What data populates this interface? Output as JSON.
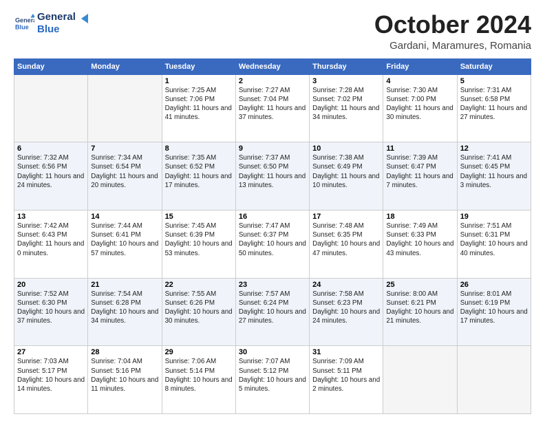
{
  "header": {
    "logo_line1": "General",
    "logo_line2": "Blue",
    "month": "October 2024",
    "location": "Gardani, Maramures, Romania"
  },
  "weekdays": [
    "Sunday",
    "Monday",
    "Tuesday",
    "Wednesday",
    "Thursday",
    "Friday",
    "Saturday"
  ],
  "weeks": [
    [
      {
        "day": "",
        "info": ""
      },
      {
        "day": "",
        "info": ""
      },
      {
        "day": "1",
        "info": "Sunrise: 7:25 AM\nSunset: 7:06 PM\nDaylight: 11 hours and 41 minutes."
      },
      {
        "day": "2",
        "info": "Sunrise: 7:27 AM\nSunset: 7:04 PM\nDaylight: 11 hours and 37 minutes."
      },
      {
        "day": "3",
        "info": "Sunrise: 7:28 AM\nSunset: 7:02 PM\nDaylight: 11 hours and 34 minutes."
      },
      {
        "day": "4",
        "info": "Sunrise: 7:30 AM\nSunset: 7:00 PM\nDaylight: 11 hours and 30 minutes."
      },
      {
        "day": "5",
        "info": "Sunrise: 7:31 AM\nSunset: 6:58 PM\nDaylight: 11 hours and 27 minutes."
      }
    ],
    [
      {
        "day": "6",
        "info": "Sunrise: 7:32 AM\nSunset: 6:56 PM\nDaylight: 11 hours and 24 minutes."
      },
      {
        "day": "7",
        "info": "Sunrise: 7:34 AM\nSunset: 6:54 PM\nDaylight: 11 hours and 20 minutes."
      },
      {
        "day": "8",
        "info": "Sunrise: 7:35 AM\nSunset: 6:52 PM\nDaylight: 11 hours and 17 minutes."
      },
      {
        "day": "9",
        "info": "Sunrise: 7:37 AM\nSunset: 6:50 PM\nDaylight: 11 hours and 13 minutes."
      },
      {
        "day": "10",
        "info": "Sunrise: 7:38 AM\nSunset: 6:49 PM\nDaylight: 11 hours and 10 minutes."
      },
      {
        "day": "11",
        "info": "Sunrise: 7:39 AM\nSunset: 6:47 PM\nDaylight: 11 hours and 7 minutes."
      },
      {
        "day": "12",
        "info": "Sunrise: 7:41 AM\nSunset: 6:45 PM\nDaylight: 11 hours and 3 minutes."
      }
    ],
    [
      {
        "day": "13",
        "info": "Sunrise: 7:42 AM\nSunset: 6:43 PM\nDaylight: 11 hours and 0 minutes."
      },
      {
        "day": "14",
        "info": "Sunrise: 7:44 AM\nSunset: 6:41 PM\nDaylight: 10 hours and 57 minutes."
      },
      {
        "day": "15",
        "info": "Sunrise: 7:45 AM\nSunset: 6:39 PM\nDaylight: 10 hours and 53 minutes."
      },
      {
        "day": "16",
        "info": "Sunrise: 7:47 AM\nSunset: 6:37 PM\nDaylight: 10 hours and 50 minutes."
      },
      {
        "day": "17",
        "info": "Sunrise: 7:48 AM\nSunset: 6:35 PM\nDaylight: 10 hours and 47 minutes."
      },
      {
        "day": "18",
        "info": "Sunrise: 7:49 AM\nSunset: 6:33 PM\nDaylight: 10 hours and 43 minutes."
      },
      {
        "day": "19",
        "info": "Sunrise: 7:51 AM\nSunset: 6:31 PM\nDaylight: 10 hours and 40 minutes."
      }
    ],
    [
      {
        "day": "20",
        "info": "Sunrise: 7:52 AM\nSunset: 6:30 PM\nDaylight: 10 hours and 37 minutes."
      },
      {
        "day": "21",
        "info": "Sunrise: 7:54 AM\nSunset: 6:28 PM\nDaylight: 10 hours and 34 minutes."
      },
      {
        "day": "22",
        "info": "Sunrise: 7:55 AM\nSunset: 6:26 PM\nDaylight: 10 hours and 30 minutes."
      },
      {
        "day": "23",
        "info": "Sunrise: 7:57 AM\nSunset: 6:24 PM\nDaylight: 10 hours and 27 minutes."
      },
      {
        "day": "24",
        "info": "Sunrise: 7:58 AM\nSunset: 6:23 PM\nDaylight: 10 hours and 24 minutes."
      },
      {
        "day": "25",
        "info": "Sunrise: 8:00 AM\nSunset: 6:21 PM\nDaylight: 10 hours and 21 minutes."
      },
      {
        "day": "26",
        "info": "Sunrise: 8:01 AM\nSunset: 6:19 PM\nDaylight: 10 hours and 17 minutes."
      }
    ],
    [
      {
        "day": "27",
        "info": "Sunrise: 7:03 AM\nSunset: 5:17 PM\nDaylight: 10 hours and 14 minutes."
      },
      {
        "day": "28",
        "info": "Sunrise: 7:04 AM\nSunset: 5:16 PM\nDaylight: 10 hours and 11 minutes."
      },
      {
        "day": "29",
        "info": "Sunrise: 7:06 AM\nSunset: 5:14 PM\nDaylight: 10 hours and 8 minutes."
      },
      {
        "day": "30",
        "info": "Sunrise: 7:07 AM\nSunset: 5:12 PM\nDaylight: 10 hours and 5 minutes."
      },
      {
        "day": "31",
        "info": "Sunrise: 7:09 AM\nSunset: 5:11 PM\nDaylight: 10 hours and 2 minutes."
      },
      {
        "day": "",
        "info": ""
      },
      {
        "day": "",
        "info": ""
      }
    ]
  ]
}
